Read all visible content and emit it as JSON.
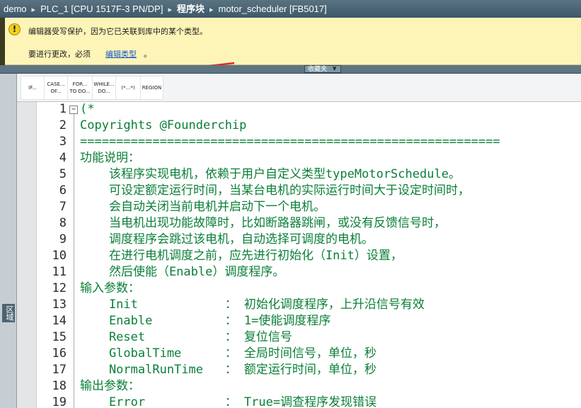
{
  "breadcrumb": [
    {
      "label": "demo",
      "bold": false
    },
    {
      "label": "PLC_1 [CPU 1517F-3 PN/DP]",
      "bold": false
    },
    {
      "label": "程序块",
      "bold": true
    },
    {
      "label": "motor_scheduler [FB5017]",
      "bold": false
    }
  ],
  "breadcrumb_separator": "▸",
  "warning": {
    "icon": "!",
    "line1": "编辑器受写保护，因为它已关联到库中的某个类型。",
    "line2_prefix": "要进行更改，必须",
    "link": "编辑类型",
    "line2_suffix": "。",
    "arrow_color": "#e8231b"
  },
  "toolbar": {
    "handle_label": "收藏夹"
  },
  "left_dock": {
    "label": "区域"
  },
  "palette": [
    "IF...",
    "CASE...\nOF...",
    "FOR...\nTO DO...",
    "WHILE...\nDO...",
    "(*...*)",
    "REGION"
  ],
  "editor": {
    "fold_symbol": "−",
    "code_color": "#0a7f37",
    "lines": [
      {
        "n": "1",
        "text": "(*"
      },
      {
        "n": "2",
        "text": "Copyrights @Founderchip"
      },
      {
        "n": "3",
        "text": "=========================================================="
      },
      {
        "n": "4",
        "text": "功能说明："
      },
      {
        "n": "5",
        "text": "    该程序实现电机，依赖于用户自定义类型typeMotorSchedule。"
      },
      {
        "n": "6",
        "text": "    可设定额定运行时间，当某台电机的实际运行时间大于设定时间时，"
      },
      {
        "n": "7",
        "text": "    会自动关闭当前电机并启动下一个电机。"
      },
      {
        "n": "8",
        "text": "    当电机出现功能故障时，比如断路器跳闸，或没有反馈信号时，"
      },
      {
        "n": "9",
        "text": "    调度程序会跳过该电机，自动选择可调度的电机。"
      },
      {
        "n": "10",
        "text": "    在进行电机调度之前，应先进行初始化（Init）设置，"
      },
      {
        "n": "11",
        "text": "    然后使能（Enable）调度程序。"
      },
      {
        "n": "12",
        "text": "输入参数："
      },
      {
        "n": "13",
        "text": "    Init            ： 初始化调度程序，上升沿信号有效"
      },
      {
        "n": "14",
        "text": "    Enable          ： 1=使能调度程序"
      },
      {
        "n": "15",
        "text": "    Reset           ： 复位信号"
      },
      {
        "n": "16",
        "text": "    GlobalTime      ： 全局时间信号，单位，秒"
      },
      {
        "n": "17",
        "text": "    NormalRunTime   ： 额定运行时间，单位，秒"
      },
      {
        "n": "18",
        "text": "输出参数："
      },
      {
        "n": "19",
        "text": "    Error           ： True=调查程序发现错误"
      }
    ]
  }
}
